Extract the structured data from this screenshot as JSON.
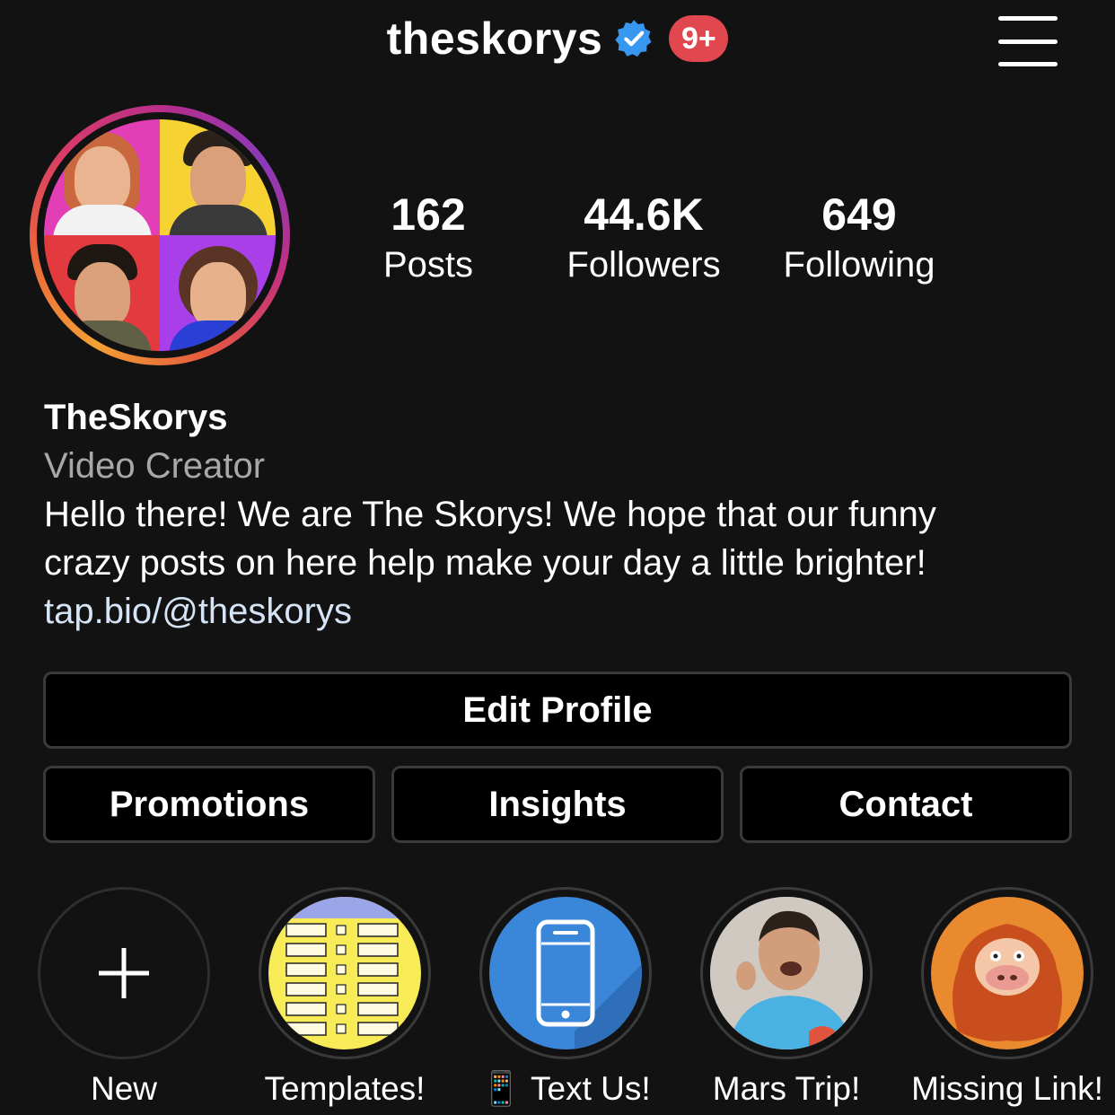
{
  "header": {
    "username": "theskorys",
    "notification_badge": "9+",
    "verified_icon": "verified-badge-icon",
    "menu_icon": "hamburger-menu-icon"
  },
  "stats": {
    "posts": {
      "value": "162",
      "label": "Posts"
    },
    "followers": {
      "value": "44.6K",
      "label": "Followers"
    },
    "following": {
      "value": "649",
      "label": "Following"
    }
  },
  "bio": {
    "name": "TheSkorys",
    "category": "Video Creator",
    "line1": "Hello there! We are The Skorys! We hope that our funny",
    "line2": "crazy posts on here help make your day a little brighter!",
    "link": "tap.bio/@theskorys"
  },
  "buttons": {
    "edit_profile": "Edit Profile",
    "promotions": "Promotions",
    "insights": "Insights",
    "contact": "Contact"
  },
  "highlights": [
    {
      "label": "New"
    },
    {
      "label": "Templates!"
    },
    {
      "label": "📱 Text Us!"
    },
    {
      "label": "Mars Trip!"
    },
    {
      "label": "Missing Link!"
    }
  ],
  "colors": {
    "background": "#121212",
    "badge": "#e0474f",
    "verified": "#3897f0",
    "link": "#d5e4f6",
    "secondary_text": "#a8a8a8"
  }
}
